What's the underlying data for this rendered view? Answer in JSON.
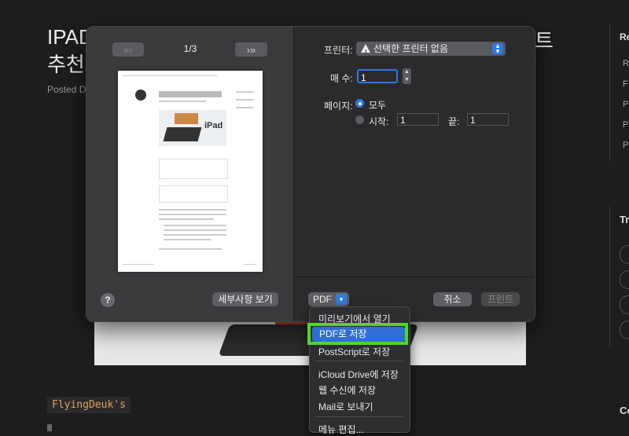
{
  "background": {
    "title_left": "IPAD",
    "title_left_line2": "추천",
    "title_right": "트",
    "posted": "Posted D",
    "sidebar_heading": "Re",
    "sidebar_items": [
      "R",
      "F",
      "P",
      "P",
      "P"
    ],
    "sidebar_heading_2": "Tr",
    "sidebar_heading_3": "Co",
    "author_tag": "FlyingDeuk's"
  },
  "preview": {
    "page_indicator": "1/3",
    "nav_left": "«‹",
    "nav_right": "›»",
    "image_text": "iPad"
  },
  "dialog": {
    "printer_label": "프린터:",
    "printer_value": "선택한 프린터 없음",
    "copies_label": "매 수:",
    "copies_value": "1",
    "pages_label": "페이지:",
    "pages_all": "모두",
    "pages_from_label": "시작:",
    "pages_from_value": "1",
    "pages_to_label": "끝:",
    "pages_to_value": "1",
    "help_label": "?",
    "details_button": "세부사항 보기",
    "pdf_button": "PDF",
    "cancel_button": "취소",
    "print_button": "프린트"
  },
  "pdf_menu": {
    "items": [
      "미리보기에서 열기",
      "PDF로 저장",
      "PostScript로 저장",
      "iCloud Drive에 저장",
      "웹 수신에 저장",
      "Mail로 보내기",
      "메뉴 편집..."
    ],
    "selected": "PDF로 저장"
  },
  "colors": {
    "accent": "#2f7ae5",
    "highlight": "#4dd82a",
    "background": "#1d1d1f"
  }
}
